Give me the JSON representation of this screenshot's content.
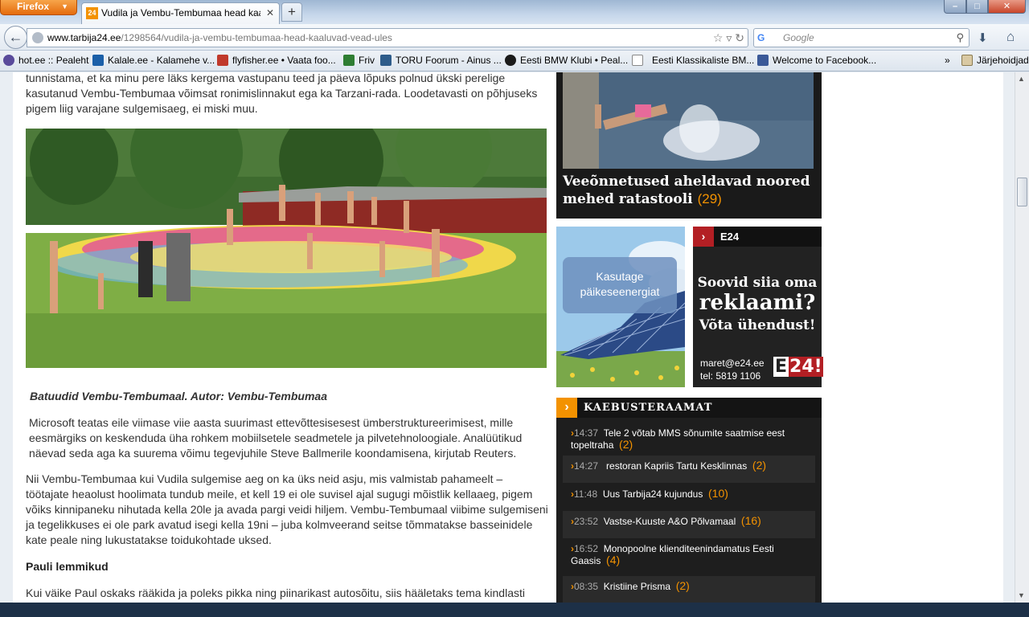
{
  "browser": {
    "app_button": "Firefox",
    "tab": {
      "label": "Vudila ja Vembu-Tembumaa head kaalu...",
      "favicon": "24"
    },
    "new_tab": "+",
    "url": {
      "domain": "www.tarbija24.ee",
      "path": "/1298564/vudila-ja-vembu-tembumaa-head-kaaluvad-vead-ules"
    },
    "search": {
      "engine": "G",
      "placeholder": "Google"
    },
    "bookmarks": [
      {
        "label": "hot.ee :: Pealeht",
        "color": "#5a4b9b"
      },
      {
        "label": "Kalale.ee - Kalamehe v...",
        "color": "#1b5fa8"
      },
      {
        "label": "flyfisher.ee • Vaata foo...",
        "color": "#c0392b"
      },
      {
        "label": "Friv",
        "color": "#2e7d32"
      },
      {
        "label": "TORU Foorum - Ainus ...",
        "color": "#2e5c8a"
      },
      {
        "label": "Eesti BMW Klubi • Peal...",
        "color": "#1a1a1a"
      },
      {
        "label": "Eesti Klassikaliste BM...",
        "color": "#ffffff"
      },
      {
        "label": "Welcome to Facebook...",
        "color": "#3b5998"
      }
    ],
    "bookmarks_overflow": "»",
    "bookmarks_folder": "Järjehoidjad"
  },
  "article": {
    "para_top": "tunnistama, et ka minu pere läks kergema vastupanu teed ja päeva lõpuks polnud ükski perelige kasutanud Vembu-Tembumaa võimsat ronimislinnakut ega ka Tarzani-rada. Loodetavasti on põhjuseks pigem liig varajane sulgemisaeg, ei miski muu.",
    "caption": "Batuudid Vembu-Tembumaal. Autor: Vembu-Tembumaa",
    "para_1": "Microsoft teatas eile viimase viie aasta suurimast ettevõttesisesest ümberstruktureerimisest, mille eesmärgiks on keskenduda üha rohkem mobiilsetele seadmetele ja pilvetehnoloogiale. Analüütikud näevad seda aga ka suurema võimu tegevjuhile Steve Ballmerile koondamisena, kirjutab Reuters.",
    "para_2": "Nii Vembu-Tembumaa kui Vudila sulgemise aeg on ka üks neid asju, mis valmistab pahameelt –  töötajate heaolust hoolimata tundub meile, et kell 19 ei ole suvisel ajal sugugi mõistlik kellaaeg, pigem võiks kinnipaneku nihutada kella 20le ja avada pargi veidi hiljem. Vembu-Tembumaal viibime sulgemiseni ja tegelikkuses ei ole park avatud isegi kella 19ni – juba kolmveerand seitse tõmmatakse basseinidele kate peale ning lukustatakse toidukohtade uksed.",
    "subhead": "Pauli lemmikud",
    "para_3": "Kui väike Paul oskaks rääkida ja poleks pikka ning piinarikast autosõitu, siis hääletaks tema kindlasti Vembu-Tembumaa poolt. Sest Vudilas on päris väikestele lastele ainult üks liivakast kitšihõnguliste plastikust"
  },
  "sidebar": {
    "news": {
      "title": "Veeõnnetused aheldavad noored mehed ratastooli",
      "count": "(29)"
    },
    "solar_ad": {
      "text_1": "Kasutage",
      "text_2": "päikeseenergiat"
    },
    "e24_ad": {
      "header": "E24",
      "line1": "Soovid siia oma",
      "line2": "reklaami?",
      "line3": "Võta ühendust!",
      "email": "maret@e24.ee",
      "phone": "tel: 5819 1106",
      "logo_e": "E",
      "logo_n": "24!"
    },
    "complaints": {
      "title": "KAEBUSTERAAMAT",
      "items": [
        {
          "time": "14:37",
          "text": "Tele 2 võtab MMS sõnumite saatmise eest topeltraha",
          "count": "(2)"
        },
        {
          "time": "14:27",
          "text": " restoran Kapriis Tartu Kesklinnas",
          "count": "(2)"
        },
        {
          "time": "11:48",
          "text": "Uus Tarbija24 kujundus",
          "count": "(10)"
        },
        {
          "time": "23:52",
          "text": "Vastse-Kuuste A&O Põlvamaal",
          "count": "(16)"
        },
        {
          "time": "16:52",
          "text": "Monopoolne klienditeenindamatus Eesti Gaasis",
          "count": "(4)"
        },
        {
          "time": "08:35",
          "text": "Kristiine Prisma",
          "count": "(2)"
        }
      ]
    }
  },
  "colors": {
    "accent": "#f39200",
    "e24_red": "#b31f24",
    "dark": "#1e1e1e"
  }
}
